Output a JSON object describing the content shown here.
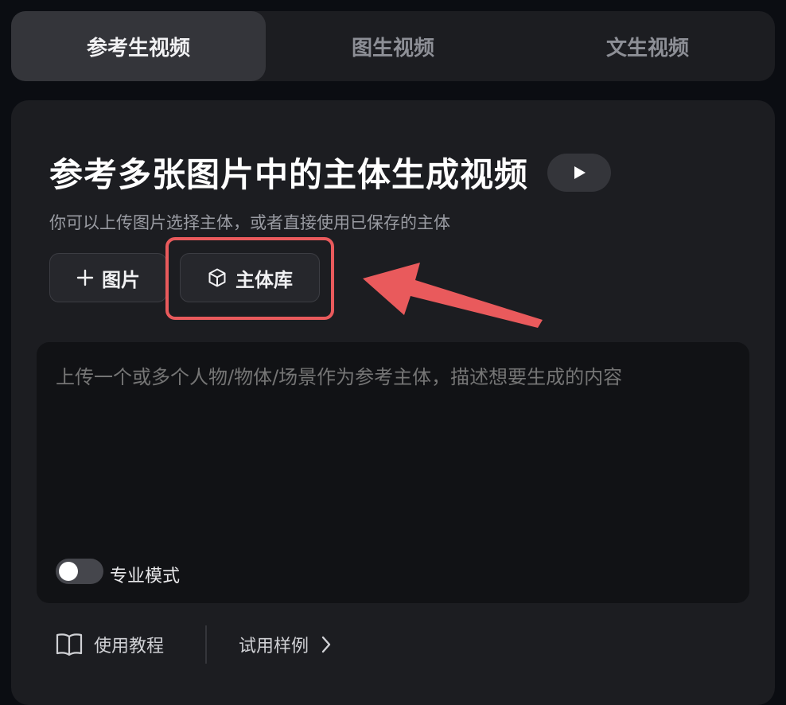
{
  "tabs": [
    {
      "label": "参考生视频",
      "active": true
    },
    {
      "label": "图生视频",
      "active": false
    },
    {
      "label": "文生视频",
      "active": false
    }
  ],
  "panel": {
    "title": "参考多张图片中的主体生成视频",
    "play_icon": "play-icon",
    "subtitle": "你可以上传图片选择主体，或者直接使用已保存的主体",
    "add_image_label": "图片",
    "add_icon": "plus-icon",
    "library_label": "主体库",
    "library_icon": "cube-icon",
    "prompt_placeholder": "上传一个或多个人物/物体/场景作为参考主体，描述想要生成的内容",
    "pro_mode_label": "专业模式",
    "pro_mode_on": false
  },
  "footer": {
    "tutorial_label": "使用教程",
    "tutorial_icon": "book-icon",
    "examples_label": "试用样例",
    "examples_icon": "chevron-right-icon"
  },
  "annotation": {
    "highlight_color": "#e95a5c"
  }
}
